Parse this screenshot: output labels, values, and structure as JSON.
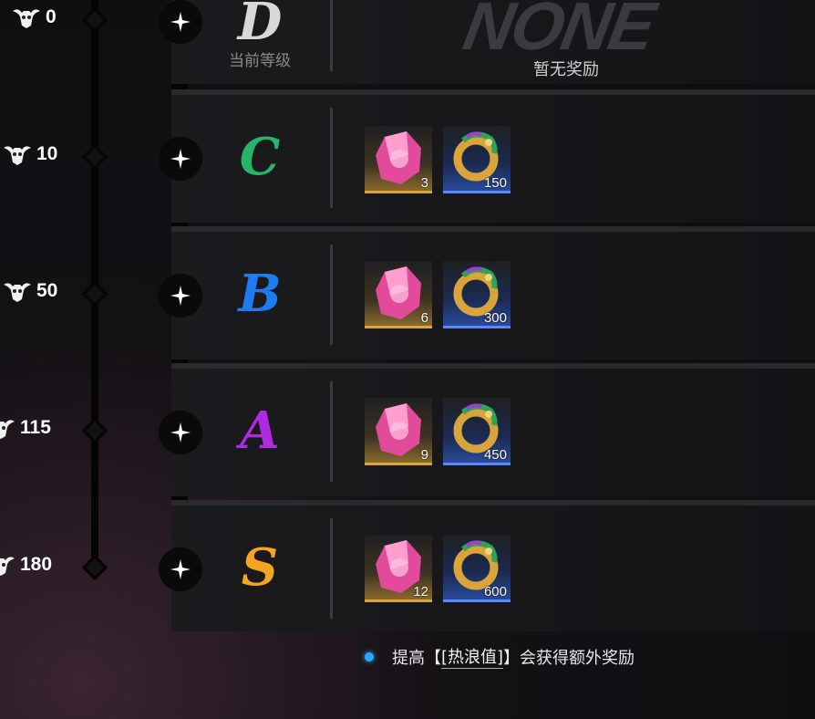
{
  "current_grade_caption": "当前等级",
  "no_reward": {
    "watermark": "NONE",
    "caption": "暂无奖励"
  },
  "tiers": [
    {
      "score": "0",
      "grade": "D",
      "grade_color": "#d8d8d8",
      "rewards": []
    },
    {
      "score": "10",
      "grade": "C",
      "grade_color": "#27b36a",
      "rewards": [
        {
          "type": "gem",
          "qty": "3"
        },
        {
          "type": "coin",
          "qty": "150"
        }
      ]
    },
    {
      "score": "50",
      "grade": "B",
      "grade_color": "#1e7cf0",
      "rewards": [
        {
          "type": "gem",
          "qty": "6"
        },
        {
          "type": "coin",
          "qty": "300"
        }
      ]
    },
    {
      "score": "115",
      "grade": "A",
      "grade_color": "#b02ae0",
      "rewards": [
        {
          "type": "gem",
          "qty": "9"
        },
        {
          "type": "coin",
          "qty": "450"
        }
      ]
    },
    {
      "score": "180",
      "grade": "S",
      "grade_color": "#f5a51f",
      "rewards": [
        {
          "type": "gem",
          "qty": "12"
        },
        {
          "type": "coin",
          "qty": "600"
        }
      ]
    }
  ],
  "footer": {
    "prefix": "提高【",
    "keyword": "[热浪值]",
    "suffix": "】会获得额外奖励"
  },
  "icons": {
    "score": "bull-skull-icon",
    "row_marker": "sparkle-star-icon",
    "gem": "pink-crystal-icon",
    "coin": "dragon-ring-icon",
    "hint": "hint-dot-icon"
  }
}
